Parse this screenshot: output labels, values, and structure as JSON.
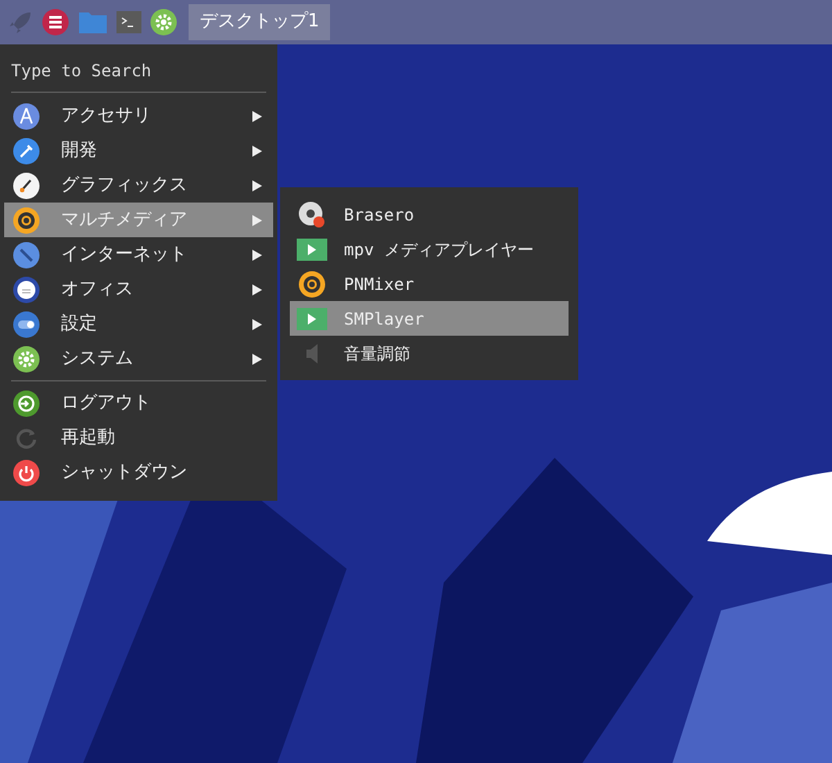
{
  "taskbar": {
    "workspace": "デスクトップ1"
  },
  "menu": {
    "search": {
      "placeholder": "Type to Search"
    },
    "categories": [
      {
        "label": "アクセサリ",
        "selected": false,
        "submenu": true
      },
      {
        "label": "開発",
        "selected": false,
        "submenu": true
      },
      {
        "label": "グラフィックス",
        "selected": false,
        "submenu": true
      },
      {
        "label": "マルチメディア",
        "selected": true,
        "submenu": true
      },
      {
        "label": "インターネット",
        "selected": false,
        "submenu": true
      },
      {
        "label": "オフィス",
        "selected": false,
        "submenu": true
      },
      {
        "label": "設定",
        "selected": false,
        "submenu": true
      },
      {
        "label": "システム",
        "selected": false,
        "submenu": true
      }
    ],
    "session": [
      {
        "label": "ログアウト",
        "selected": false
      },
      {
        "label": "再起動",
        "selected": false
      },
      {
        "label": "シャットダウン",
        "selected": false
      }
    ]
  },
  "submenu": {
    "items": [
      {
        "label": "Brasero",
        "selected": false
      },
      {
        "label": "mpv メディアプレイヤー",
        "selected": false
      },
      {
        "label": "PNMixer",
        "selected": false
      },
      {
        "label": "SMPlayer",
        "selected": true
      },
      {
        "label": "音量調節",
        "selected": false
      }
    ]
  }
}
